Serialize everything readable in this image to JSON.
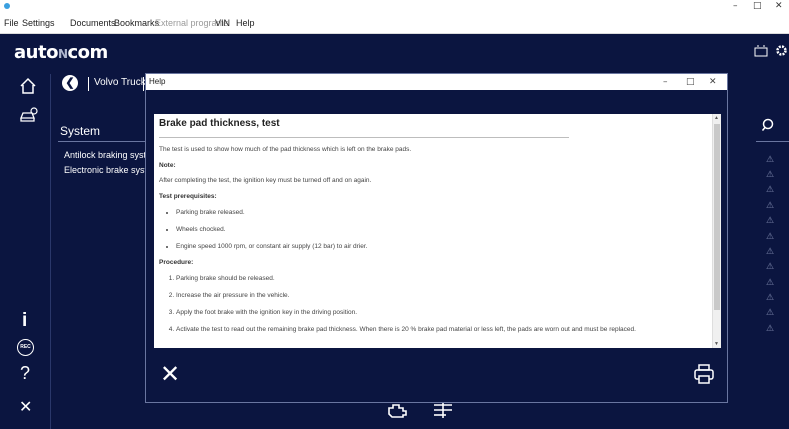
{
  "menubar": {
    "items": [
      "File",
      "Settings",
      "Documents",
      "Bookmarks",
      "External programs",
      "VIN",
      "Help"
    ]
  },
  "app": {
    "logo_left": "auto",
    "logo_mid": "N",
    "logo_right": "com",
    "breadcrumb": "Volvo Trucks",
    "system_title": "System",
    "systems": [
      "Antilock braking syster",
      "Electronic brake syster"
    ]
  },
  "dialog": {
    "title": "Help",
    "heading": "Brake pad thickness, test",
    "intro": "The test is used to show how much of the pad thickness which is left on the brake pads.",
    "note_label": "Note:",
    "note_text": "After completing the test, the ignition key must be turned off and on again.",
    "prereq_label": "Test prerequisites:",
    "prereqs": [
      "Parking brake released.",
      "Wheels chocked.",
      "Engine speed 1000 rpm, or constant air supply (12 bar) to air drier."
    ],
    "procedure_label": "Procedure:",
    "steps": [
      "Parking brake should be released.",
      "Increase the air pressure in the vehicle.",
      "Apply the foot brake with the ignition key in the driving position.",
      "Activate the test to read out the remaining brake pad thickness. When there is 20 % brake pad material or less left, the pads are worn out and must be replaced."
    ]
  },
  "nav": {
    "rec_label": "REC",
    "info": "i",
    "help": "?",
    "close": "✕"
  }
}
